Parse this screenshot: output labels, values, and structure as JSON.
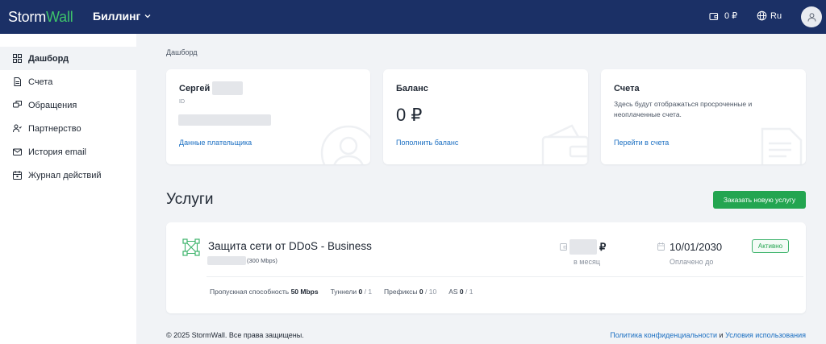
{
  "header": {
    "logo_storm": "Storm",
    "logo_wall": "Wall",
    "product": "Биллинг",
    "balance": "0 ₽",
    "language": "Ru"
  },
  "sidebar": {
    "items": [
      {
        "label": "Дашборд",
        "icon": "dashboard-icon",
        "active": true
      },
      {
        "label": "Счета",
        "icon": "document-icon"
      },
      {
        "label": "Обращения",
        "icon": "chat-icon"
      },
      {
        "label": "Партнерство",
        "icon": "users-icon"
      },
      {
        "label": "История email",
        "icon": "mail-icon"
      },
      {
        "label": "Журнал действий",
        "icon": "calendar-icon"
      }
    ]
  },
  "breadcrumb": "Дашборд",
  "cards": {
    "user": {
      "name": "Сергей",
      "id_label": "ID",
      "link": "Данные плательщика"
    },
    "balance": {
      "title": "Баланс",
      "amount": "0 ₽",
      "link": "Пополнить баланс"
    },
    "invoices": {
      "title": "Счета",
      "text": "Здесь будут отображаться просроченные и неоплаченные счета.",
      "link": "Перейти в счета"
    }
  },
  "services": {
    "title": "Услуги",
    "order_button": "Заказать новую услугу",
    "items": [
      {
        "name": "Защита сети от DDoS - Business",
        "subtitle": "(300 Mbps)",
        "price_currency": "₽",
        "price_period": "в месяц",
        "paid_until": "10/01/2030",
        "paid_until_label": "Оплачено до",
        "status": "Активно",
        "stats": {
          "bandwidth_label": "Пропускная способность",
          "bandwidth_value": "50 Mbps",
          "tunnels_label": "Туннели",
          "tunnels_used": "0",
          "tunnels_total": "/ 1",
          "prefixes_label": "Префиксы",
          "prefixes_used": "0",
          "prefixes_total": "/ 10",
          "as_label": "AS",
          "as_used": "0",
          "as_total": "/ 1"
        }
      }
    ]
  },
  "footer": {
    "copyright": "© 2025 StormWall. Все права защищены.",
    "privacy": "Политика конфиденциальности",
    "and": "и",
    "terms": "Условия использования"
  },
  "colors": {
    "header_bg": "#1b3066",
    "accent_green": "#23a550",
    "link_blue": "#1b6fc2",
    "page_bg": "#f1f3f6"
  }
}
